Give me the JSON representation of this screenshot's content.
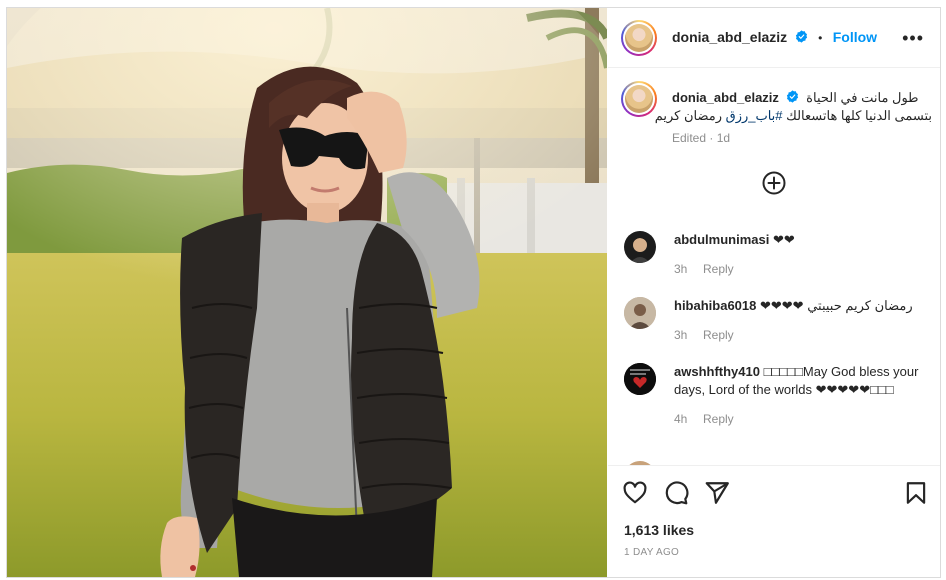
{
  "post": {
    "username": "donia_abd_elaziz",
    "follow_label": "Follow",
    "more_label": "•••",
    "caption": {
      "line1": "طول مانت في الحياة",
      "line2_pre": "بتسمى الدنيا كلها هاتسعالك ",
      "hashtag": "#باب_رزق",
      "line2_post": " رمضان كريم",
      "meta": "Edited · 1d"
    },
    "comments": [
      {
        "username": "abdulmunimasi",
        "text": "❤❤",
        "time": "3h",
        "reply": "Reply"
      },
      {
        "username": "hibahiba6018",
        "text": "❤❤❤❤ رمضان كريم حبيبتي",
        "time": "3h",
        "reply": "Reply"
      },
      {
        "username": "awshhfthy410",
        "text": "□□□□□May God bless your days, Lord of the worlds ❤❤❤❤❤□□□",
        "time": "4h",
        "reply": "Reply"
      }
    ],
    "likes": "1,613 likes",
    "date": "1 DAY AGO",
    "colors": {
      "accent": "#0095f6",
      "hashtag": "#00376b",
      "muted": "#8e8e8e"
    },
    "icons": [
      "verified-badge-icon",
      "add-circle-icon",
      "heart-icon",
      "comment-icon",
      "share-icon",
      "save-icon",
      "more-options-icon"
    ]
  }
}
